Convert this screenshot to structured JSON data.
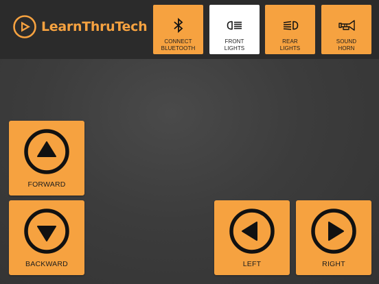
{
  "brand": {
    "name": "LearnThruTech",
    "color": "#f6a240"
  },
  "toolbar": [
    {
      "id": "bluetooth",
      "label": "CONNECT\nBLUETOOTH",
      "icon": "bluetooth-icon",
      "active": false
    },
    {
      "id": "front-lights",
      "label": "FRONT\nLIGHTS",
      "icon": "headlight-icon",
      "active": true
    },
    {
      "id": "rear-lights",
      "label": "REAR\nLIGHTS",
      "icon": "rear-light-icon",
      "active": false
    },
    {
      "id": "horn",
      "label": "SOUND\nHORN",
      "icon": "horn-icon",
      "active": false
    }
  ],
  "controls": {
    "forward": {
      "label": "FORWARD",
      "icon": "arrow-up-icon"
    },
    "backward": {
      "label": "BACKWARD",
      "icon": "arrow-down-icon"
    },
    "left": {
      "label": "LEFT",
      "icon": "arrow-left-icon"
    },
    "right": {
      "label": "RIGHT",
      "icon": "arrow-right-icon"
    }
  },
  "colors": {
    "accent": "#f6a240",
    "header_bg": "#2b2b2b",
    "active_button": "#ffffff",
    "icon": "#111111"
  }
}
